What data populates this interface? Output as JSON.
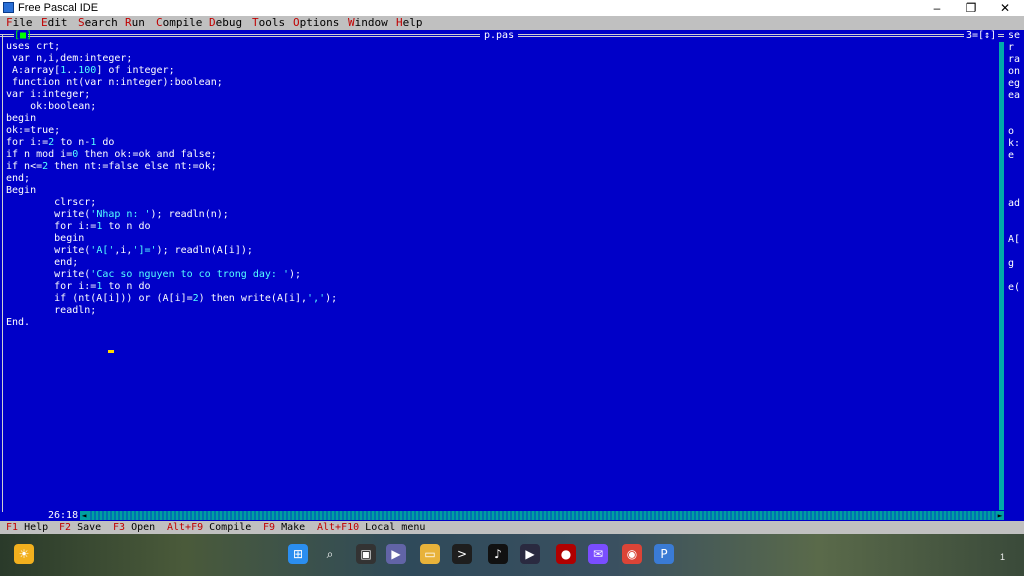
{
  "window": {
    "title": "Free Pascal IDE",
    "controls": [
      "–",
      "❐",
      "✕"
    ]
  },
  "menu": [
    {
      "hot": "F",
      "rest": "ile"
    },
    {
      "hot": "E",
      "rest": "dit"
    },
    {
      "hot": "S",
      "rest": "earch"
    },
    {
      "hot": "R",
      "rest": "un"
    },
    {
      "hot": "C",
      "rest": "ompile"
    },
    {
      "hot": "D",
      "rest": "ebug"
    },
    {
      "hot": "T",
      "rest": "ools"
    },
    {
      "hot": "O",
      "rest": "ptions"
    },
    {
      "hot": "W",
      "rest": "indow"
    },
    {
      "hot": "H",
      "rest": "elp"
    }
  ],
  "editor": {
    "filename": "p.pas",
    "close_box": "[■]",
    "window_number": "3=[↕]",
    "cursor_position": "26:18",
    "lines": [
      "uses crt;",
      " var n,i,dem:integer;",
      " A:array[1..100] of integer;",
      " function nt(var n:integer):boolean;",
      "var i:integer;",
      "    ok:boolean;",
      "begin",
      "ok:=true;",
      "for i:=2 to n-1 do",
      "if n mod i=0 then ok:=ok and false;",
      "if n<=2 then nt:=false else nt:=ok;",
      "end;",
      "Begin",
      "        clrscr;",
      "        write('Nhap n: '); readln(n);",
      "        for i:=1 to n do",
      "        begin",
      "        write('A[',i,']='); readln(A[i]);",
      "        end;",
      "        write('Cac so nguyen to co trong day: ');",
      "        for i:=1 to n do",
      "        if (nt(A[i])) or (A[i]=2) then write(A[i],',');",
      "        readln;",
      "End."
    ]
  },
  "right_window": {
    "fragments": [
      {
        "row": 0,
        "text": "se"
      },
      {
        "row": 1,
        "text": "r"
      },
      {
        "row": 2,
        "text": "ra"
      },
      {
        "row": 3,
        "text": "on"
      },
      {
        "row": 4,
        "text": "eg"
      },
      {
        "row": 5,
        "text": "ea"
      },
      {
        "row": 8,
        "text": "o"
      },
      {
        "row": 9,
        "text": "k:"
      },
      {
        "row": 10,
        "text": "e"
      },
      {
        "row": 14,
        "text": "ad"
      },
      {
        "row": 17,
        "text": "A["
      },
      {
        "row": 19,
        "text": "g"
      },
      {
        "row": 21,
        "text": "e("
      }
    ]
  },
  "statusbar": [
    {
      "key": "F1",
      "label": "Help"
    },
    {
      "key": "F2",
      "label": "Save"
    },
    {
      "key": "F3",
      "label": "Open"
    },
    {
      "key": "Alt+F9",
      "label": "Compile"
    },
    {
      "key": "F9",
      "label": "Make"
    },
    {
      "key": "Alt+F10",
      "label": "Local menu"
    }
  ],
  "taskbar": {
    "icons": [
      "weather-icon",
      "windows-start-icon",
      "search-icon",
      "task-view-icon",
      "teams-chat-icon",
      "file-explorer-icon",
      "terminal-icon",
      "tiktok-icon",
      "media-player-icon",
      "security-icon",
      "messenger-icon",
      "chrome-icon",
      "free-pascal-icon"
    ],
    "badge": "1"
  },
  "colors": {
    "editor_bg": "#0000c8",
    "menu_bg": "#c0c0c0",
    "hotkey": "#c00000",
    "literal": "#55ffff"
  }
}
